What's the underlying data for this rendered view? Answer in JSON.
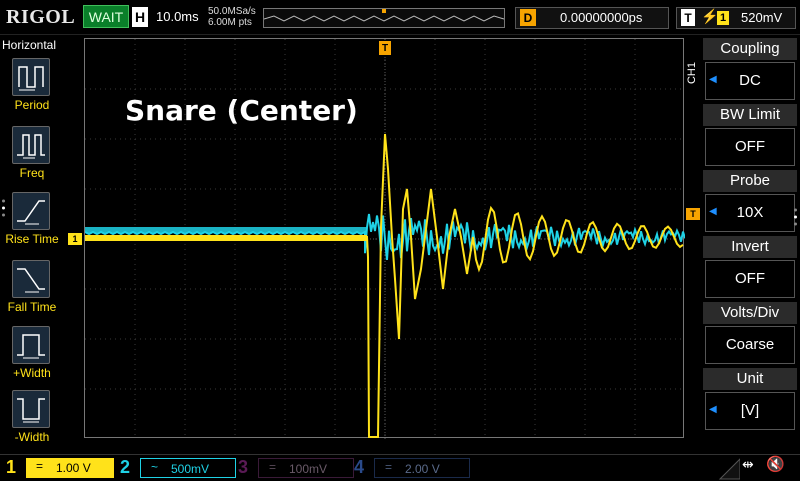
{
  "topbar": {
    "logo": "RIGOL",
    "status": "WAIT",
    "horizontal_label": "H",
    "timebase": "10.0ms",
    "sample_rate": "50.0MSa/s",
    "memory_depth": "6.00M pts",
    "trigger_delay_label": "D",
    "trigger_delay_value": "0.00000000ps",
    "trigger_label": "T",
    "trigger_source": "1",
    "trigger_level": "520mV"
  },
  "left_menu": {
    "title": "Horizontal",
    "items": [
      {
        "label": "Period",
        "icon": "period-icon"
      },
      {
        "label": "Freq",
        "icon": "frequency-icon"
      },
      {
        "label": "Rise Time",
        "icon": "rise-time-icon"
      },
      {
        "label": "Fall Time",
        "icon": "fall-time-icon"
      },
      {
        "label": "+Width",
        "icon": "positive-width-icon"
      },
      {
        "label": "-Width",
        "icon": "negative-width-icon"
      }
    ]
  },
  "screen": {
    "title": "Snare (Center)",
    "trigger_marker": "T",
    "ch1_marker": "1",
    "trigger_level_marker": "T"
  },
  "right_menu": {
    "channel_tag": "CH1",
    "items": [
      {
        "header": "Coupling",
        "value": "DC",
        "has_arrow": true
      },
      {
        "header": "BW Limit",
        "value": "OFF",
        "has_arrow": false
      },
      {
        "header": "Probe",
        "value": "10X",
        "has_arrow": true
      },
      {
        "header": "Invert",
        "value": "OFF",
        "has_arrow": false
      },
      {
        "header": "Volts/Div",
        "value": "Coarse",
        "has_arrow": false
      },
      {
        "header": "Unit",
        "value": "[V]",
        "has_arrow": true
      }
    ]
  },
  "bottom_bar": {
    "channels": [
      {
        "number": "1",
        "coupling": "=",
        "scale": "1.00 V",
        "color": "#ffe21a",
        "active": true
      },
      {
        "number": "2",
        "coupling": "~",
        "scale": "500mV",
        "color": "#1fd2e6",
        "active": true
      },
      {
        "number": "3",
        "coupling": "=",
        "scale": "100mV",
        "color": "#a0208f",
        "active": false
      },
      {
        "number": "4",
        "coupling": "=",
        "scale": "2.00 V",
        "color": "#2a5fd6",
        "active": false
      }
    ]
  },
  "colors": {
    "ch1": "#ffe21a",
    "ch2": "#1fd2e6",
    "trigger": "#f7a400",
    "status_bg": "#0a7f2a"
  }
}
